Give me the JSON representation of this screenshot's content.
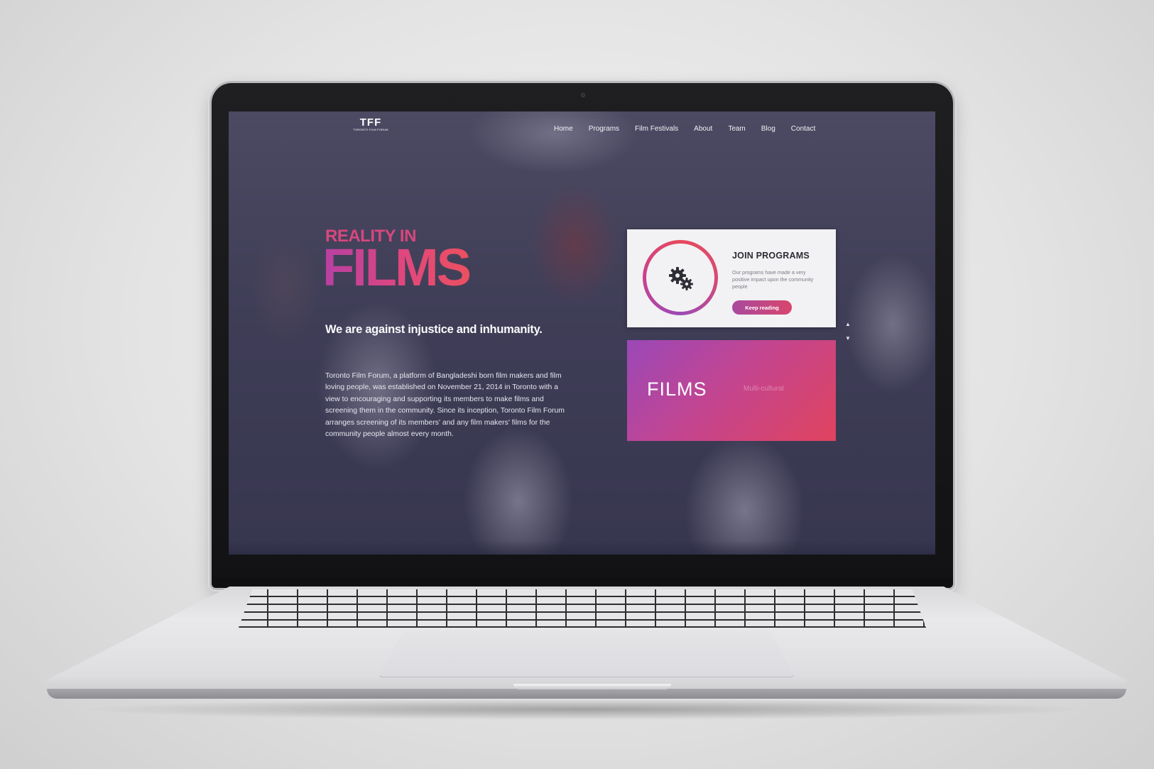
{
  "site": {
    "logo": {
      "mark": "TFF",
      "subtitle": "TORONTO FILM FORUM"
    },
    "nav": [
      {
        "label": "Home"
      },
      {
        "label": "Programs"
      },
      {
        "label": "Film Festivals"
      },
      {
        "label": "About"
      },
      {
        "label": "Team"
      },
      {
        "label": "Blog"
      },
      {
        "label": "Contact"
      }
    ],
    "hero": {
      "kicker": "REALITY IN",
      "title": "FILMS",
      "tagline": "We are against injustice and inhumanity.",
      "intro": "Toronto Film Forum, a platform of Bangladeshi born film makers and film loving people, was established on November 21, 2014 in Toronto with a view to encouraging and supporting its members to make films and screening them in the community. Since its inception, Toronto Film Forum arranges screening of its members' and any film makers' films for the community people almost every month."
    },
    "program_card": {
      "icon": "gears-icon",
      "title": "JOIN PROGRAMS",
      "text": "Our programs have made a very positive impact upon the community people",
      "button": "Keep reading"
    },
    "films_tile": {
      "title": "FILMS",
      "subtitle": "Multi-cultural"
    },
    "scroll": {
      "up": "▲",
      "down": "▼"
    }
  },
  "colors": {
    "accent_pink": "#d8477f",
    "accent_purple": "#9a48b8",
    "accent_red": "#e0435e",
    "overlay": "#34325a"
  }
}
